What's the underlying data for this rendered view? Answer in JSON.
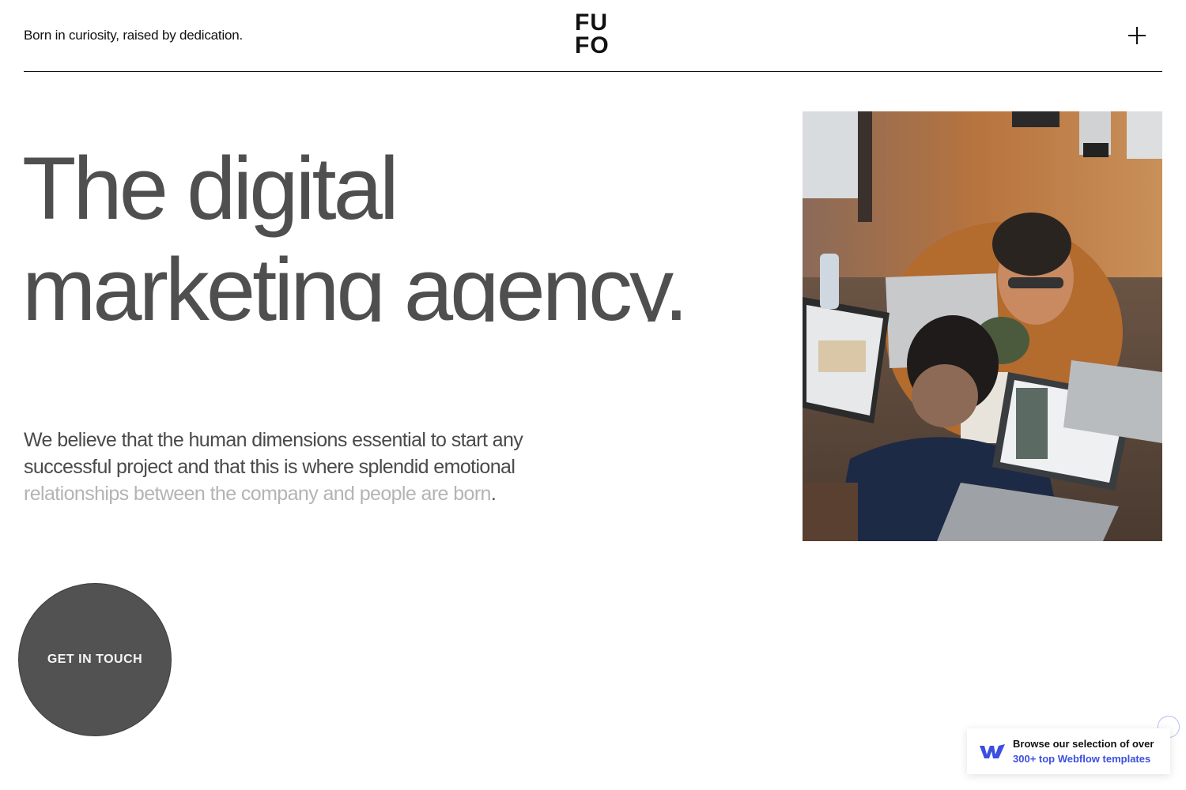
{
  "header": {
    "tagline": "Born in curiosity, raised by dedication.",
    "logo_line1": "FU",
    "logo_line2": "FO",
    "menu_icon": "plus-icon"
  },
  "hero": {
    "title_line1": "The digital",
    "title_line2": "marketing agency.",
    "intro_text": "We believe that the human dimensions essential to start any successful project and that this is where splendid emotional ",
    "intro_faded": "relationships between the company and people are born",
    "intro_end": ".",
    "image_description": "people working on laptops"
  },
  "cta": {
    "label": "GET IN TOUCH"
  },
  "promo": {
    "icon": "webflow-logo-icon",
    "line1": "Browse our selection of over",
    "line2": "300+ top Webflow templates",
    "link_color": "#3c4fe0"
  },
  "colors": {
    "title": "#4f4f4f",
    "cta_bg": "#525252"
  }
}
